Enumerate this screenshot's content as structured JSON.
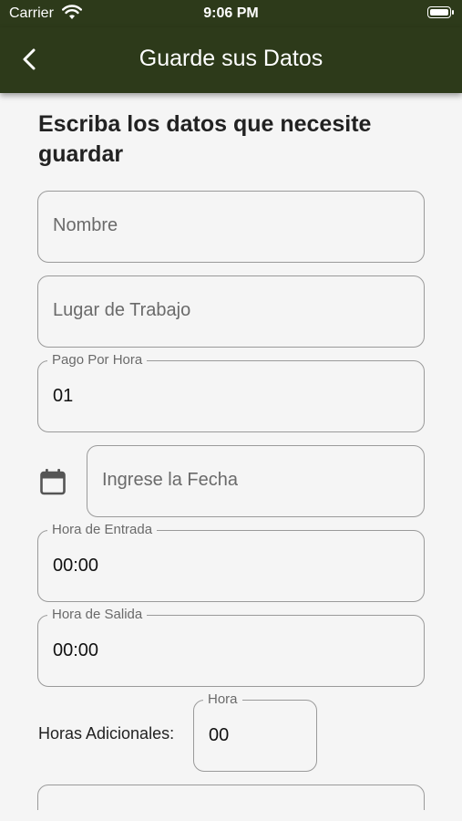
{
  "status": {
    "carrier": "Carrier",
    "time": "9:06 PM"
  },
  "appbar": {
    "title": "Guarde sus Datos"
  },
  "form": {
    "heading": "Escriba los datos que necesite guardar",
    "nombre": {
      "placeholder": "Nombre"
    },
    "lugar": {
      "placeholder": "Lugar de Trabajo"
    },
    "pago": {
      "label": "Pago Por Hora",
      "value": "01"
    },
    "fecha": {
      "placeholder": "Ingrese la Fecha"
    },
    "entrada": {
      "label": "Hora de Entrada",
      "value": "00:00"
    },
    "salida": {
      "label": "Hora de Salida",
      "value": "00:00"
    },
    "adicionales": {
      "label": "Horas Adicionales:",
      "field_label": "Hora",
      "value": "00"
    }
  },
  "colors": {
    "appbar": "#2d3a1a",
    "background": "#f5f5f5",
    "border": "#9a9a9a"
  }
}
